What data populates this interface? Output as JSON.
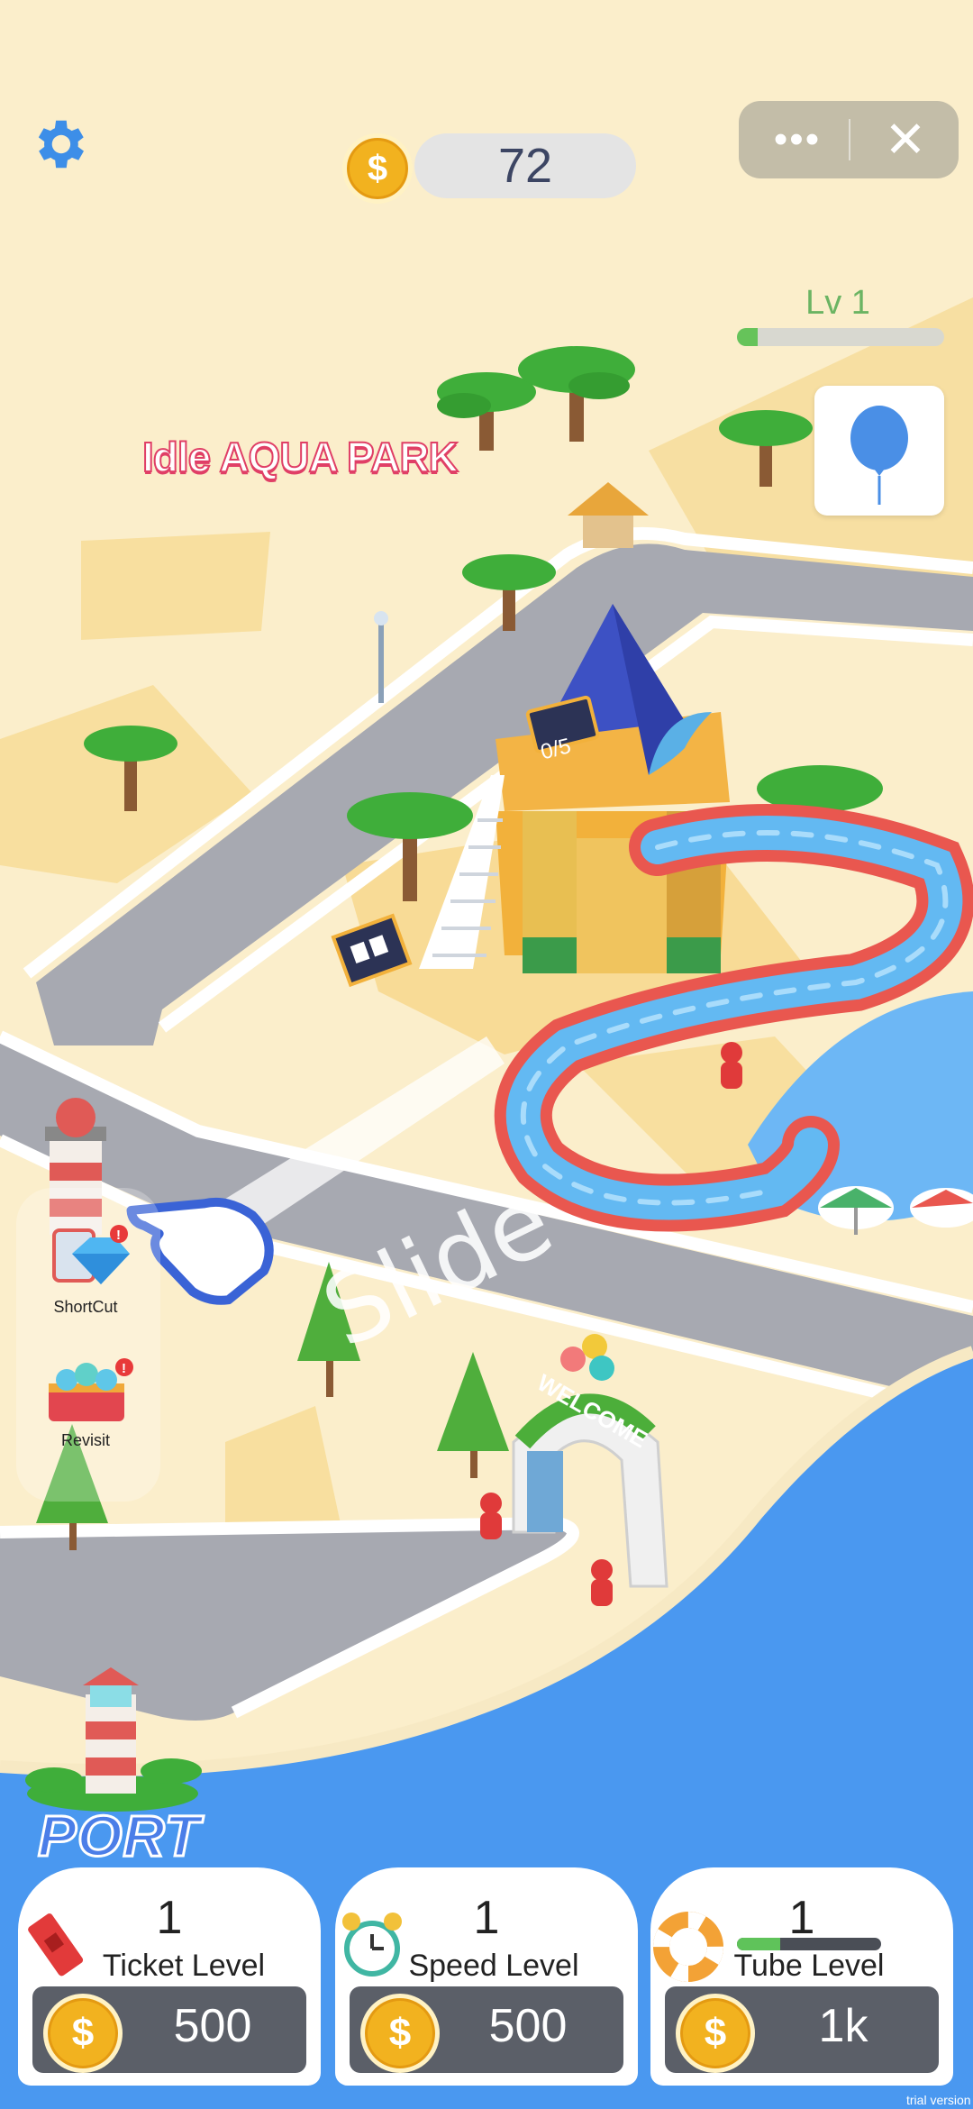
{
  "hud": {
    "coins": "72",
    "more_glyph": "•••",
    "close_glyph": "✕",
    "coin_glyph": "$"
  },
  "level": {
    "label": "Lv 1",
    "progress": 0.1
  },
  "park_title": "Idle AQUA PARK",
  "tower": {
    "counter": "0/5"
  },
  "shortcuts": {
    "shortcut_label": "ShortCut",
    "revisit_label": "Revisit"
  },
  "tutorial": {
    "slide_text": "Slide"
  },
  "sign": {
    "welcome_text": "WELCOME"
  },
  "port": {
    "label": "PORT"
  },
  "upgrades": [
    {
      "level": "1",
      "name": "Ticket Level",
      "price": "500",
      "icon": "ticket-icon"
    },
    {
      "level": "1",
      "name": "Speed Level",
      "price": "500",
      "icon": "alarm-clock-icon"
    },
    {
      "level": "1",
      "name": "Tube Level",
      "price": "1k",
      "icon": "swim-ring-icon",
      "progress": 0.3
    }
  ],
  "watermark": "trial version",
  "colors": {
    "sea": "#4a98f0",
    "sand": "#fbe7b5",
    "road": "#a7a9b1",
    "slide_red": "#e9574f",
    "button": "#5b5f68"
  }
}
